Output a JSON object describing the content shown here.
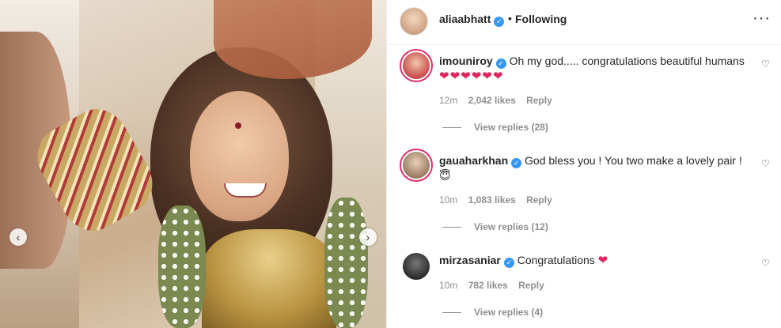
{
  "header": {
    "username": "aliaabhatt",
    "separator": "•",
    "follow_status": "Following",
    "more_icon": "more-horizontal-icon"
  },
  "media": {
    "prev_icon": "chevron-left-icon",
    "next_icon": "chevron-right-icon",
    "prev_glyph": "‹",
    "next_glyph": "›"
  },
  "comments": [
    {
      "username": "imouniroy",
      "text": "Oh my god..... congratulations beautiful humans",
      "emoji": "❤❤❤❤❤❤",
      "time": "12m",
      "likes": "2,042 likes",
      "reply_label": "Reply",
      "view_replies": "View replies (28)",
      "avatar_color": "#c94b4b"
    },
    {
      "username": "gauaharkhan",
      "text": "God bless you ! You two make a lovely pair !",
      "emoji": "😇",
      "time": "10m",
      "likes": "1,083 likes",
      "reply_label": "Reply",
      "view_replies": "View replies (12)",
      "avatar_color": "#9a7b62"
    },
    {
      "username": "mirzasaniar",
      "text": "Congratulations",
      "emoji": "❤",
      "time": "10m",
      "likes": "782 likes",
      "reply_label": "Reply",
      "view_replies": "View replies (4)",
      "avatar_color": "#2b2b2b"
    }
  ],
  "verified_glyph": "✓",
  "heart_glyph": "♡",
  "colors": {
    "verified": "#3897f0",
    "heart": "#e0245e",
    "muted": "#8e8e8e"
  }
}
